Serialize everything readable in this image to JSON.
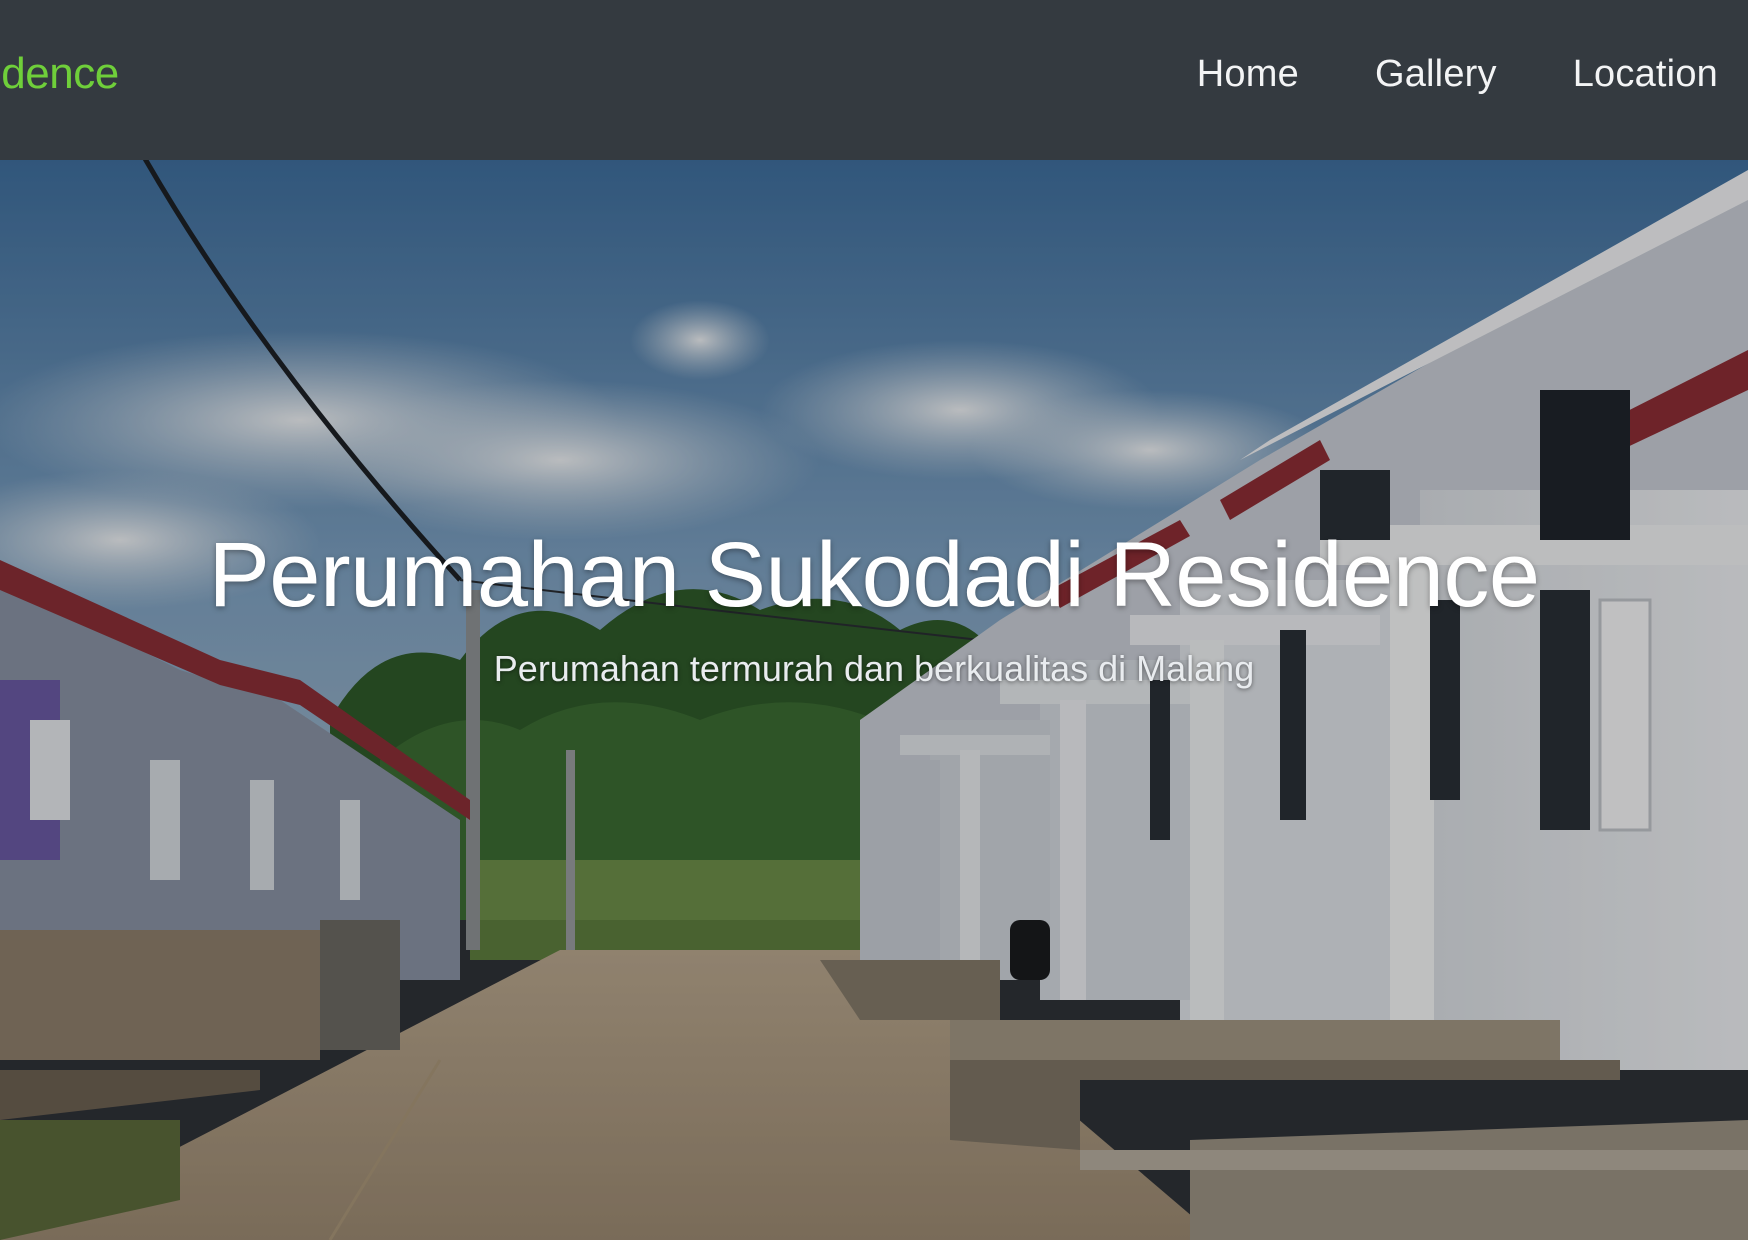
{
  "navbar": {
    "brand": "idence",
    "brand_color": "#6fcf3a",
    "background_color": "#343a40",
    "links": [
      {
        "label": "Home"
      },
      {
        "label": "Gallery"
      },
      {
        "label": "Location"
      }
    ]
  },
  "hero": {
    "title": "Perumahan Sukodadi Residence",
    "subtitle": "Perumahan termurah dan berkualitas di Malang",
    "background_image": "housing-street-photo"
  }
}
